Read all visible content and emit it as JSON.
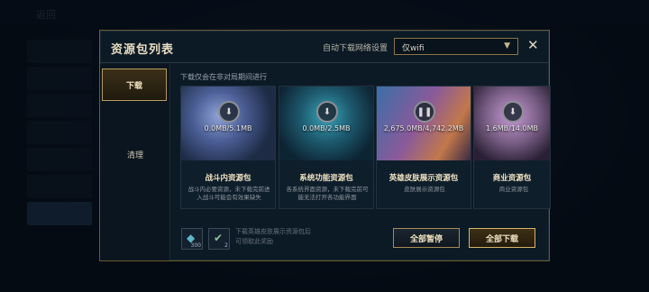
{
  "background": {
    "back_label": "返回"
  },
  "dialog": {
    "title": "资源包列表",
    "auto_download_label": "自动下载网络设置",
    "network_option": "仅wifi",
    "close_icon": "close-icon",
    "chevron_icon": "chevron-down-icon"
  },
  "nav": {
    "items": [
      {
        "label": "下载"
      },
      {
        "label": "清理"
      }
    ]
  },
  "note": "下载仅会在非对局期间进行",
  "cards": [
    {
      "title": "战斗内资源包",
      "size": "0.0MB/5.1MB",
      "state_icon": "download-icon",
      "desc": "战斗内必要资源，未下载完前进入战斗可能会有效果缺失",
      "accent": "#5b6fa0"
    },
    {
      "title": "系统功能资源包",
      "size": "0.0MB/2.5MB",
      "state_icon": "download-icon",
      "desc": "各系统界面资源，未下载完前可能无法打开各功能界面",
      "accent": "#2a6f86"
    },
    {
      "title": "英雄皮肤展示资源包",
      "size": "2,675.0MB/4,742.2MB",
      "state_icon": "pause-icon",
      "desc": "皮肤展示资源包",
      "accent": "#6c4a7a"
    },
    {
      "title": "商业资源包",
      "size": "1.6MB/14.0MB",
      "state_icon": "download-icon",
      "desc": "商业资源包",
      "accent": "#7a5f86"
    }
  ],
  "footer": {
    "icons": [
      {
        "name": "item-300-icon",
        "count": "300"
      },
      {
        "name": "item-2-icon",
        "count": "2"
      }
    ],
    "hint": "下载英雄皮肤展示资源包后可领取此奖励",
    "pause_all_label": "全部暂停",
    "download_all_label": "全部下载"
  },
  "colors": {
    "accent_gold": "#b79a5b",
    "panel": "#0c1a26"
  }
}
